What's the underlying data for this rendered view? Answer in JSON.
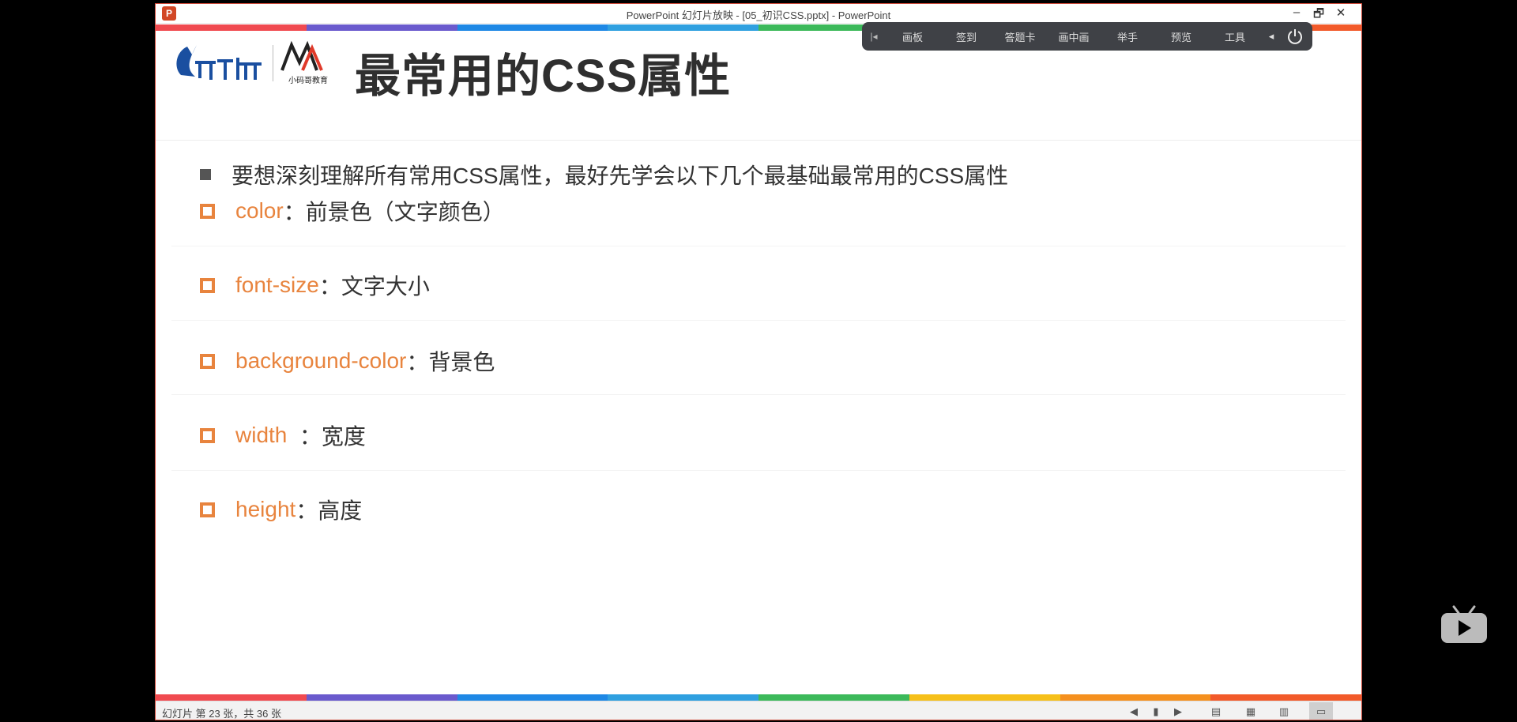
{
  "window": {
    "title": "PowerPoint 幻灯片放映 - [05_初识CSS.pptx] - PowerPoint",
    "controls": {
      "minimize": "–",
      "restore": "🗗",
      "close": "✕"
    },
    "app_icon_letter": "P"
  },
  "stripe_colors": [
    "#f04a50",
    "#6a5acd",
    "#1e88e5",
    "#2fa0e0",
    "#3cb95a",
    "#f6c01a",
    "#f5901e",
    "#f25a2a"
  ],
  "toolbar": {
    "collapse": "|◂",
    "items": [
      "画板",
      "签到",
      "答题卡",
      "画中画",
      "举手",
      "预览",
      "工具"
    ],
    "arrow": "◂"
  },
  "slide": {
    "title": "最常用的CSS属性",
    "logo2_text": "小码哥教育",
    "intro": "要想深刻理解所有常用CSS属性，最好先学会以下几个最基础最常用的CSS属性",
    "properties": [
      {
        "name": "color",
        "desc": "：前景色（文字颜色）"
      },
      {
        "name": "font-size",
        "desc": "：文字大小"
      },
      {
        "name": "background-color",
        "desc": "：背景色"
      },
      {
        "name": "width ",
        "desc": " ：宽度"
      },
      {
        "name": "height",
        "desc": "：高度"
      }
    ]
  },
  "statusbar": {
    "text": "幻灯片 第 23 张，共 36 张"
  },
  "colors": {
    "accent": "#e8843e",
    "title": "#2f2f2f",
    "toolbar_bg": "#3f4146"
  }
}
